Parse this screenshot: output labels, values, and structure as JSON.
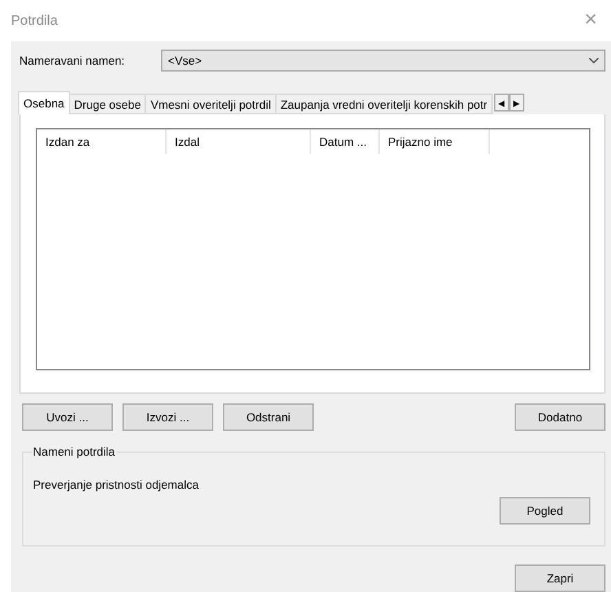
{
  "window": {
    "title": "Potrdila",
    "close": "×"
  },
  "purpose": {
    "label": "Nameravani namen:",
    "value": "<Vse>"
  },
  "tabs": [
    {
      "label": "Osebna",
      "selected": true
    },
    {
      "label": "Druge osebe",
      "selected": false
    },
    {
      "label": "Vmesni overitelji potrdil",
      "selected": false
    },
    {
      "label": "Zaupanja vredni overitelji korenskih potr",
      "selected": false
    }
  ],
  "tab_scroll": [
    "◀",
    "▶"
  ],
  "table": {
    "columns": [
      "Izdan za",
      "Izdal",
      "Datum ...",
      "Prijazno ime"
    ]
  },
  "actions": [
    "Uvozi ...",
    "Izvozi ...",
    "Odstrani"
  ],
  "advanced_button": "Dodatno",
  "purposes_group": {
    "title": "Nameni potrdila",
    "text": "Preverjanje pristnosti odjemalca",
    "button": "Pogled"
  },
  "close_button": "Zapri"
}
